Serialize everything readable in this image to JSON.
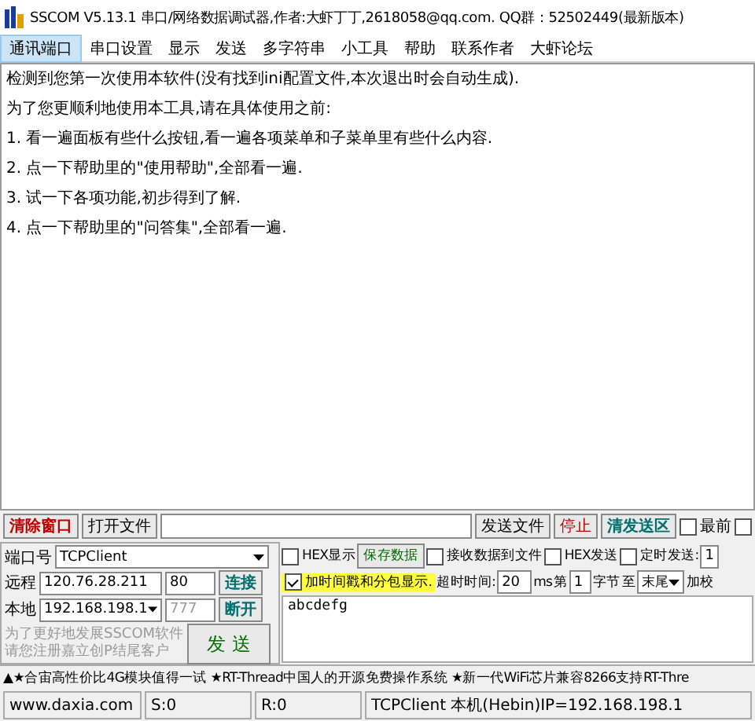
{
  "window": {
    "title": "SSCOM V5.13.1 串口/网络数据调试器,作者:大虾丁丁,2618058@qq.com. QQ群：52502449(最新版本)"
  },
  "menu": [
    {
      "label": "通讯端口",
      "selected": true
    },
    {
      "label": "串口设置",
      "selected": false
    },
    {
      "label": "显示",
      "selected": false
    },
    {
      "label": "发送",
      "selected": false
    },
    {
      "label": "多字符串",
      "selected": false
    },
    {
      "label": "小工具",
      "selected": false
    },
    {
      "label": "帮助",
      "selected": false
    },
    {
      "label": "联系作者",
      "selected": false
    },
    {
      "label": "大虾论坛",
      "selected": false
    }
  ],
  "log": [
    "检测到您第一次使用本软件(没有找到ini配置文件,本次退出时会自动生成).",
    "为了您更顺利地使用本工具,请在具体使用之前:",
    "1. 看一遍面板有些什么按钮,看一遍各项菜单和子菜单里有些什么内容.",
    "2. 点一下帮助里的\"使用帮助\",全部看一遍.",
    "3. 试一下各项功能,初步得到了解.",
    "4. 点一下帮助里的\"问答集\",全部看一遍."
  ],
  "toolbar": {
    "clear_button": "清除窗口",
    "open_file_button": "打开文件",
    "send_file_button": "发送文件",
    "stop_button": "停止",
    "clear_send_button": "清发送区",
    "topmost": {
      "label": "最前",
      "checked": false
    },
    "extra_checkbox": {
      "checked": false
    }
  },
  "connection": {
    "port_label": "端口号",
    "port_value": "TCPClient",
    "remote_label": "远程",
    "remote_ip": "120.76.28.211",
    "remote_port": "80",
    "connect_button": "连接",
    "local_label": "本地",
    "local_ip": "192.168.198.1",
    "local_port": {
      "value": "777",
      "disabled": true
    },
    "disconnect_button": "断开",
    "promo": [
      "为了更好地发展SSCOM软件",
      "请您注册嘉立创P结尾客户"
    ],
    "send_button": "发 送"
  },
  "options": {
    "hex_display": {
      "label": "HEX显示",
      "checked": false
    },
    "save_button": "保存数据",
    "receive_to_file": {
      "label": "接收数据到文件",
      "checked": false
    },
    "hex_send": {
      "label": "HEX发送",
      "checked": false
    },
    "timed_send": {
      "label": "定时发送:",
      "checked": false
    },
    "timed_value": "1",
    "timestamp": {
      "label": "加时间戳和分包显示.",
      "checked": true
    },
    "timeout_label": "超时时间:",
    "timeout_value": "20",
    "timeout_unit": "ms",
    "from_label": "第",
    "from_value": "1",
    "byte_label": "字节",
    "to_label": "至",
    "to_value": "末尾",
    "checksum_label": "加校"
  },
  "send_text": "abcdefg",
  "marquee": "▲★合宙高性价比4G模块值得一试 ★RT-Thread中国人的开源免费操作系统 ★新一代WiFi芯片兼容8266支持RT-Thre",
  "status_bar": [
    "www.daxia.com",
    "S:0",
    "R:0",
    "TCPClient 本机(Hebin)IP=192.168.198.1"
  ]
}
